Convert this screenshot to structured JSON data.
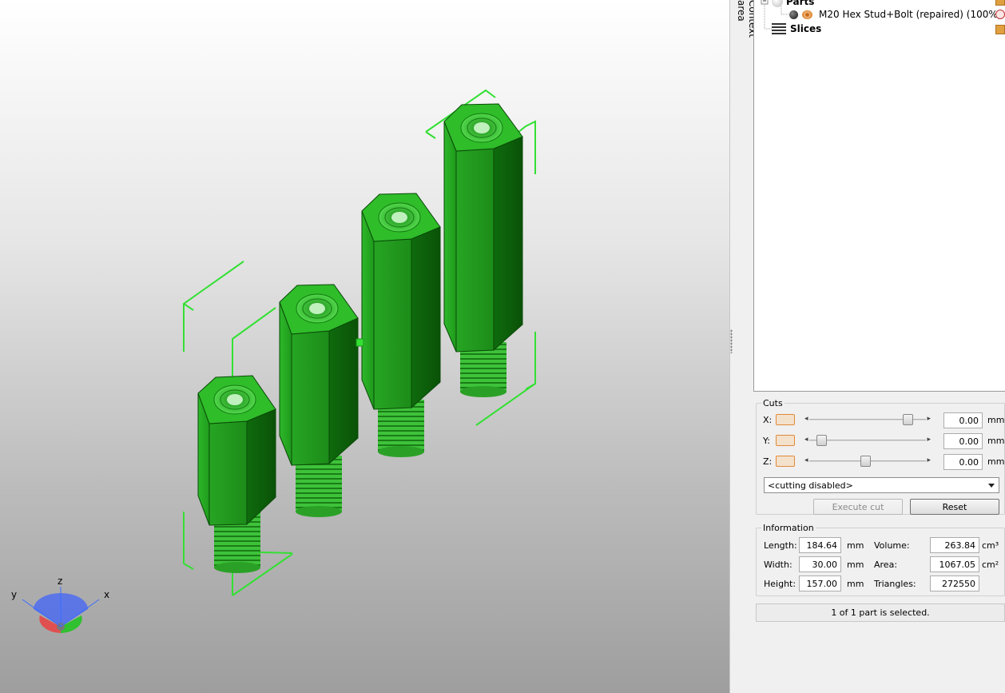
{
  "sidebar": {
    "context_tab": "Context area"
  },
  "tree": {
    "parts_label": "Parts",
    "part_name": "M20 Hex Stud+Bolt (repaired) (100%)",
    "slices_label": "Slices"
  },
  "cuts": {
    "legend": "Cuts",
    "x_label": "X:",
    "y_label": "Y:",
    "z_label": "Z:",
    "x_value": "0.00",
    "y_value": "0.00",
    "z_value": "0.00",
    "unit": "mm",
    "x_slider_pos": 0.88,
    "y_slider_pos": 0.07,
    "z_slider_pos": 0.48,
    "mode_select": "<cutting disabled>",
    "execute_label": "Execute cut",
    "reset_label": "Reset"
  },
  "information": {
    "legend": "Information",
    "length_label": "Length:",
    "length_value": "184.64",
    "width_label": "Width:",
    "width_value": "30.00",
    "height_label": "Height:",
    "height_value": "157.00",
    "length_unit": "mm",
    "width_unit": "mm",
    "height_unit": "mm",
    "volume_label": "Volume:",
    "volume_value": "263.84",
    "volume_unit": "cm³",
    "area_label": "Area:",
    "area_value": "1067.05",
    "area_unit": "cm²",
    "triangles_label": "Triangles:",
    "triangles_value": "272550"
  },
  "status": {
    "text": "1 of 1 part is selected."
  },
  "axes": {
    "x": "x",
    "y": "y",
    "z": "z"
  },
  "colors": {
    "model_green": "#22b81e",
    "selection_green": "#33e033",
    "accent_orange": "#e08a3a"
  }
}
